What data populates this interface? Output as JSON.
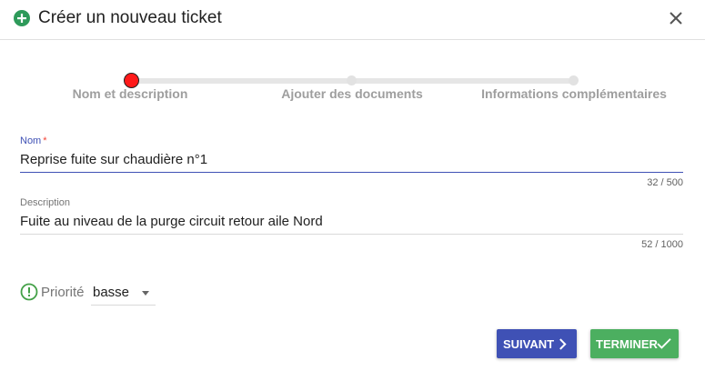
{
  "dialog": {
    "title": "Créer un nouveau ticket",
    "colors": {
      "accent": "#3f51b5",
      "success": "#4caf60",
      "active_step": "#ff1a1a"
    }
  },
  "stepper": {
    "steps": [
      {
        "label": "Nom et description",
        "active": true
      },
      {
        "label": "Ajouter des documents",
        "active": false
      },
      {
        "label": "Informations complémentaires",
        "active": false
      }
    ]
  },
  "form": {
    "name": {
      "label": "Nom",
      "required_mark": "*",
      "value": "Reprise fuite sur chaudière n°1",
      "counter": "32 / 500"
    },
    "description": {
      "label": "Description",
      "value": "Fuite au niveau de la purge circuit retour aile Nord",
      "counter": "52 / 1000"
    },
    "priority": {
      "label": "Priorité",
      "value": "basse"
    }
  },
  "actions": {
    "next_label": "SUIVANT",
    "finish_label": "TERMINER"
  },
  "icons": {
    "header": "plus-circle-icon",
    "close": "close-icon",
    "priority": "info-circle-icon"
  }
}
